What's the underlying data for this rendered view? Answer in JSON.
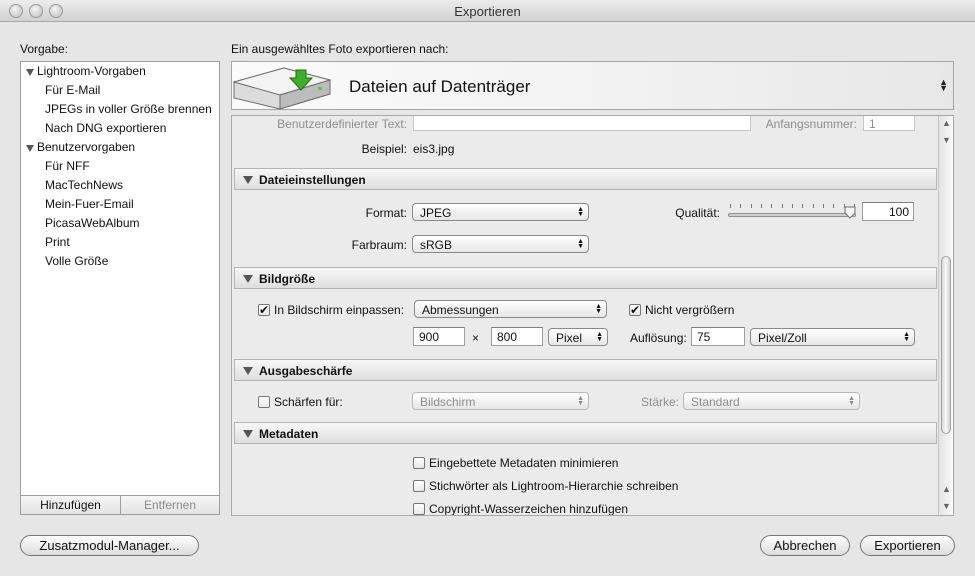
{
  "window": {
    "title": "Exportieren"
  },
  "presets": {
    "header": "Vorgabe:",
    "groups": [
      {
        "label": "Lightroom-Vorgaben",
        "items": [
          "Für E-Mail",
          "JPEGs in voller Größe brennen",
          "Nach DNG exportieren"
        ]
      },
      {
        "label": "Benutzervorgaben",
        "items": [
          "Für NFF",
          "MacTechNews",
          "Mein-Fuer-Email",
          "PicasaWebAlbum",
          "Print",
          "Volle Größe"
        ]
      }
    ],
    "add_label": "Hinzufügen",
    "remove_label": "Entfernen"
  },
  "export_target": {
    "header": "Ein ausgewähltes Foto exportieren nach:",
    "selected": "Dateien auf Datenträger"
  },
  "naming": {
    "custom_text_label": "Benutzerdefinierter Text:",
    "custom_text_value": "",
    "start_number_label": "Anfangsnummer:",
    "start_number_value": "1",
    "example_label": "Beispiel:",
    "example_value": "eis3.jpg"
  },
  "file_settings": {
    "title": "Dateieinstellungen",
    "format_label": "Format:",
    "format_value": "JPEG",
    "quality_label": "Qualität:",
    "quality_value": "100",
    "quality_level": 1.0,
    "colorspace_label": "Farbraum:",
    "colorspace_value": "sRGB"
  },
  "image_size": {
    "title": "Bildgröße",
    "fit_checked": true,
    "fit_label": "In Bildschirm einpassen:",
    "fit_mode": "Abmessungen",
    "no_enlarge_checked": true,
    "no_enlarge_label": "Nicht vergrößern",
    "width": "900",
    "times": "×",
    "height": "800",
    "unit": "Pixel",
    "resolution_label": "Auflösung:",
    "resolution_value": "75",
    "resolution_unit": "Pixel/Zoll"
  },
  "sharpening": {
    "title": "Ausgabeschärfe",
    "sharpen_checked": false,
    "sharpen_label": "Schärfen für:",
    "sharpen_for": "Bildschirm",
    "amount_label": "Stärke:",
    "amount_value": "Standard"
  },
  "metadata": {
    "title": "Metadaten",
    "options": [
      {
        "label": "Eingebettete Metadaten minimieren",
        "checked": false
      },
      {
        "label": "Stichwörter als Lightroom-Hierarchie schreiben",
        "checked": false
      },
      {
        "label": "Copyright-Wasserzeichen hinzufügen",
        "checked": false
      }
    ]
  },
  "footer": {
    "plugin_manager_label": "Zusatzmodul-Manager...",
    "cancel_label": "Abbrechen",
    "export_label": "Exportieren"
  },
  "icons": {
    "window_buttons": [
      "close-icon",
      "minimize-icon",
      "zoom-icon"
    ],
    "target_icon": "hard-drive-download-icon",
    "disclosure": "disclosure-triangle-icon",
    "popup_arrows": "updown-arrows-icon",
    "checkmark": "✔"
  }
}
